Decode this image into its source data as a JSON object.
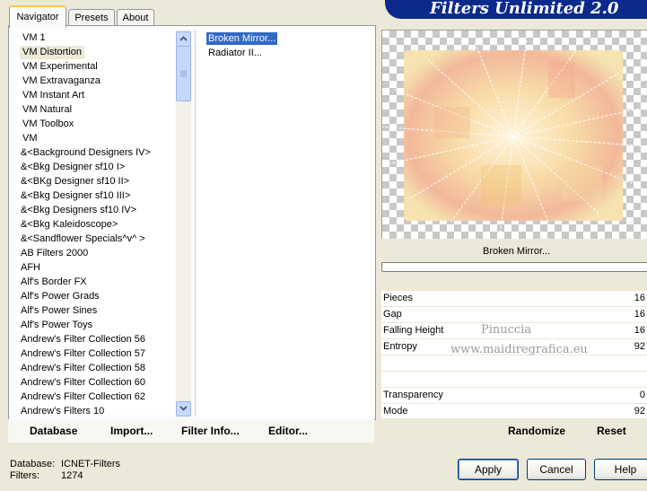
{
  "banner": {
    "title": "Filters Unlimited 2.0"
  },
  "tabs": [
    {
      "label": "Navigator",
      "active": true
    },
    {
      "label": "Presets",
      "active": false
    },
    {
      "label": "About",
      "active": false
    }
  ],
  "categories": [
    "VM 1",
    "VM Distortion",
    "VM Experimental",
    "VM Extravaganza",
    "VM Instant Art",
    "VM Natural",
    "VM Toolbox",
    "VM",
    "&<Background Designers IV>",
    "&<Bkg Designer sf10 I>",
    "&<BKg Designer sf10 II>",
    "&<Bkg Designer sf10 III>",
    "&<Bkg Designers sf10 IV>",
    "&<Bkg Kaleidoscope>",
    "&<Sandflower Specials^v^ >",
    "AB Filters 2000",
    "AFH",
    "Alf's Border FX",
    "Alf's Power Grads",
    "Alf's Power Sines",
    "Alf's Power Toys",
    "Andrew's Filter Collection 56",
    "Andrew's Filter Collection 57",
    "Andrew's Filter Collection 58",
    "Andrew's Filter Collection 60",
    "Andrew's Filter Collection 62",
    "Andrew's Filters 10"
  ],
  "selected_category_index": 1,
  "filters": [
    "Broken Mirror...",
    "Radiator II..."
  ],
  "selected_filter_index": 0,
  "bottom_links": {
    "database": "Database",
    "import": "Import...",
    "filter_info": "Filter Info...",
    "editor": "Editor..."
  },
  "preview": {
    "filter_name": "Broken Mirror...",
    "watermark_line1": "Pinuccia",
    "watermark_line2": "www.maidiregrafica.eu"
  },
  "params": [
    {
      "label": "Pieces",
      "value": "16"
    },
    {
      "label": "Gap",
      "value": "16"
    },
    {
      "label": "Falling Height",
      "value": "16"
    },
    {
      "label": "Entropy",
      "value": "92"
    },
    {
      "label": "",
      "value": ""
    },
    {
      "label": "",
      "value": ""
    },
    {
      "label": "Transparency",
      "value": "0"
    },
    {
      "label": "Mode",
      "value": "92"
    }
  ],
  "actions": {
    "randomize": "Randomize",
    "reset": "Reset"
  },
  "status": {
    "database_label": "Database:",
    "database_value": "ICNET-Filters",
    "filters_label": "Filters:",
    "filters_value": "1274"
  },
  "buttons": {
    "apply": "Apply",
    "cancel": "Cancel",
    "help": "Help"
  },
  "colors": {
    "selection": "#316ac5",
    "banner": "#0c2a8c",
    "tab_highlight": "#ffc83c"
  }
}
